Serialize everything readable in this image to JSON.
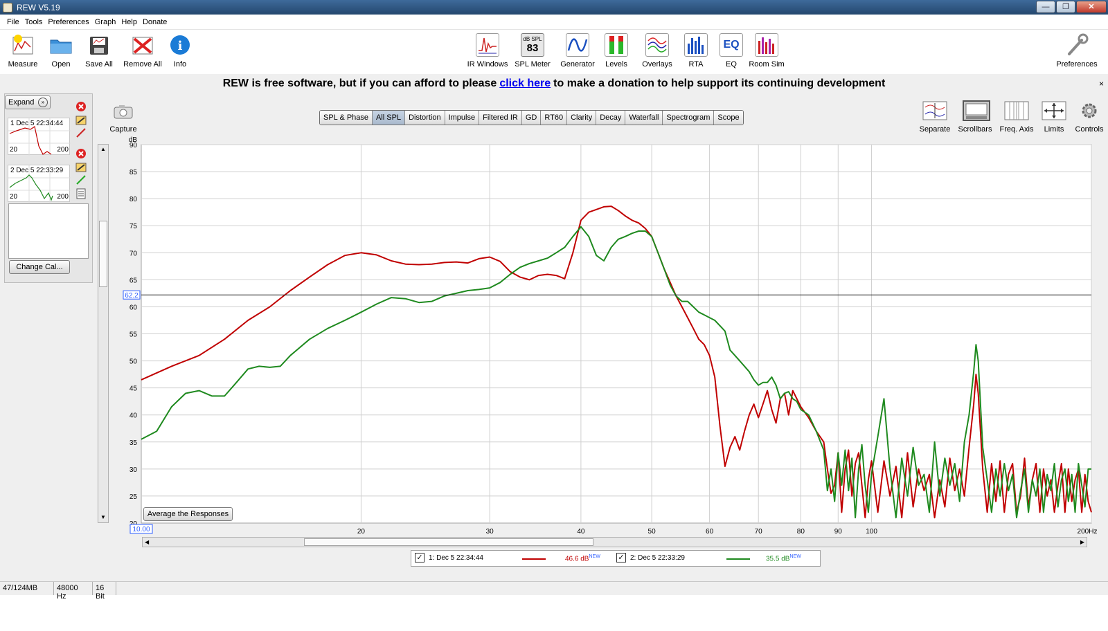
{
  "window": {
    "title": "REW V5.19",
    "min": "—",
    "max": "❐",
    "close": "✕"
  },
  "menu": [
    "File",
    "Tools",
    "Preferences",
    "Graph",
    "Help",
    "Donate"
  ],
  "toolbar_left": [
    {
      "label": "Measure",
      "icon": "measure-icon"
    },
    {
      "label": "Open",
      "icon": "folder-icon"
    },
    {
      "label": "Save All",
      "icon": "save-icon"
    },
    {
      "label": "Remove All",
      "icon": "remove-icon"
    },
    {
      "label": "Info",
      "icon": "info-icon"
    }
  ],
  "toolbar_center": [
    {
      "label": "IR Windows",
      "icon": "ir-windows-icon"
    },
    {
      "label": "SPL Meter",
      "icon": "spl-meter-icon",
      "badge_top": "dB SPL",
      "badge_value": "83"
    },
    {
      "label": "Generator",
      "icon": "generator-icon"
    },
    {
      "label": "Levels",
      "icon": "levels-icon"
    },
    {
      "label": "Overlays",
      "icon": "overlays-icon"
    },
    {
      "label": "RTA",
      "icon": "rta-icon"
    },
    {
      "label": "EQ",
      "icon": "eq-icon",
      "badge_value": "EQ"
    },
    {
      "label": "Room Sim",
      "icon": "room-sim-icon"
    }
  ],
  "preferences_label": "Preferences",
  "donate": {
    "before": "REW is free software, but if you can afford to please",
    "link": "click here",
    "after": "to make a donation to help support its continuing development",
    "close": "×"
  },
  "left_panel": {
    "expand": "Expand",
    "measurements": [
      {
        "label": "1 Dec 5 22:34:44",
        "lo": "20",
        "hi": "200",
        "color": "#c00000"
      },
      {
        "label": "2 Dec 5 22:33:29",
        "lo": "20",
        "hi": "200",
        "color": "#1f8a1f"
      }
    ],
    "change_cal": "Change Cal..."
  },
  "capture_label": "Capture",
  "tabs": [
    "SPL & Phase",
    "All SPL",
    "Distortion",
    "Impulse",
    "Filtered IR",
    "GD",
    "RT60",
    "Clarity",
    "Decay",
    "Waterfall",
    "Spectrogram",
    "Scope"
  ],
  "active_tab": "All SPL",
  "right_tools": [
    "Separate",
    "Scrollbars",
    "Freq. Axis",
    "Limits",
    "Controls"
  ],
  "avg_button": "Average the Responses",
  "cursor": {
    "y_value": "62.2",
    "x_value": "10.00"
  },
  "chart_data": {
    "type": "line",
    "ylabel": "dB",
    "xlabel": "",
    "x_unit": "Hz",
    "log_x": true,
    "xlim": [
      10,
      200
    ],
    "ylim": [
      20,
      90
    ],
    "x_ticks": [
      {
        "v": 20,
        "label": "20"
      },
      {
        "v": 30,
        "label": "30"
      },
      {
        "v": 40,
        "label": "40"
      },
      {
        "v": 50,
        "label": "50"
      },
      {
        "v": 60,
        "label": "60"
      },
      {
        "v": 70,
        "label": "70"
      },
      {
        "v": 80,
        "label": "80"
      },
      {
        "v": 90,
        "label": "90"
      },
      {
        "v": 100,
        "label": "100"
      },
      {
        "v": 200,
        "label": "200Hz"
      }
    ],
    "y_ticks": [
      25,
      30,
      35,
      40,
      45,
      50,
      55,
      60,
      65,
      70,
      75,
      80,
      85,
      90
    ],
    "grid": true,
    "hline": 62.2,
    "series": [
      {
        "name": "1: Dec 5 22:34:44",
        "color": "#c00000",
        "legend_value": "46.6 dB",
        "legend_sup": "NEW",
        "points": [
          [
            10,
            46.5
          ],
          [
            11,
            49
          ],
          [
            12,
            51
          ],
          [
            13,
            54
          ],
          [
            14,
            57.5
          ],
          [
            15,
            60
          ],
          [
            16,
            63
          ],
          [
            17,
            65.5
          ],
          [
            18,
            67.8
          ],
          [
            19,
            69.5
          ],
          [
            20,
            70
          ],
          [
            21,
            69.6
          ],
          [
            22,
            68.5
          ],
          [
            23,
            67.9
          ],
          [
            24,
            67.8
          ],
          [
            25,
            67.9
          ],
          [
            26,
            68.2
          ],
          [
            27,
            68.3
          ],
          [
            28,
            68.1
          ],
          [
            29,
            68.9
          ],
          [
            30,
            69.2
          ],
          [
            31,
            68.4
          ],
          [
            32,
            66.5
          ],
          [
            33,
            65.5
          ],
          [
            34,
            65
          ],
          [
            35,
            65.8
          ],
          [
            36,
            66
          ],
          [
            37,
            65.8
          ],
          [
            38,
            65.2
          ],
          [
            39,
            70
          ],
          [
            40,
            76
          ],
          [
            41,
            77.5
          ],
          [
            42,
            78
          ],
          [
            43,
            78.5
          ],
          [
            44,
            78.6
          ],
          [
            45,
            77.8
          ],
          [
            46,
            76.8
          ],
          [
            47,
            76
          ],
          [
            48,
            75.5
          ],
          [
            49,
            74.5
          ],
          [
            50,
            73
          ],
          [
            51,
            70
          ],
          [
            52,
            67
          ],
          [
            53,
            64.5
          ],
          [
            54,
            62
          ],
          [
            55,
            60
          ],
          [
            56,
            58
          ],
          [
            57,
            56
          ],
          [
            58,
            54
          ],
          [
            59,
            53
          ],
          [
            60,
            51
          ],
          [
            61,
            47
          ],
          [
            62,
            38
          ],
          [
            63,
            30.5
          ],
          [
            64,
            34
          ],
          [
            65,
            36
          ],
          [
            66,
            33.5
          ],
          [
            67,
            37
          ],
          [
            68,
            40
          ],
          [
            69,
            42
          ],
          [
            70,
            39.5
          ],
          [
            71,
            42
          ],
          [
            72,
            44.5
          ],
          [
            73,
            41
          ],
          [
            74,
            38.5
          ],
          [
            75,
            43
          ],
          [
            76,
            44
          ],
          [
            77,
            40
          ],
          [
            78,
            44.5
          ],
          [
            79,
            43
          ],
          [
            80,
            41.5
          ],
          [
            82,
            39.5
          ],
          [
            84,
            37
          ],
          [
            86,
            35
          ],
          [
            87,
            30
          ],
          [
            88,
            25.5
          ],
          [
            89,
            27
          ],
          [
            90,
            33
          ],
          [
            91,
            22
          ],
          [
            92,
            30
          ],
          [
            93,
            33.5
          ],
          [
            94,
            25
          ],
          [
            95,
            31
          ],
          [
            96,
            33
          ],
          [
            97,
            27
          ],
          [
            98,
            21
          ],
          [
            99,
            28
          ],
          [
            100,
            31.5
          ],
          [
            102,
            22
          ],
          [
            104,
            31.5
          ],
          [
            106,
            25
          ],
          [
            108,
            30.5
          ],
          [
            110,
            21
          ],
          [
            112,
            33
          ],
          [
            114,
            23
          ],
          [
            116,
            30
          ],
          [
            118,
            26
          ],
          [
            120,
            29
          ],
          [
            122,
            21
          ],
          [
            124,
            28
          ],
          [
            126,
            23
          ],
          [
            128,
            32
          ],
          [
            130,
            26
          ],
          [
            132,
            30
          ],
          [
            134,
            25
          ],
          [
            136,
            34
          ],
          [
            138,
            42
          ],
          [
            139,
            47.5
          ],
          [
            140,
            44
          ],
          [
            142,
            30
          ],
          [
            144,
            22
          ],
          [
            146,
            31
          ],
          [
            148,
            24
          ],
          [
            150,
            31.5
          ],
          [
            152,
            22
          ],
          [
            154,
            29
          ],
          [
            156,
            31
          ],
          [
            158,
            22
          ],
          [
            160,
            25
          ],
          [
            162,
            32
          ],
          [
            164,
            23
          ],
          [
            166,
            28
          ],
          [
            168,
            31
          ],
          [
            170,
            22
          ],
          [
            172,
            30
          ],
          [
            174,
            25
          ],
          [
            176,
            28
          ],
          [
            178,
            22
          ],
          [
            180,
            27
          ],
          [
            182,
            31
          ],
          [
            184,
            22
          ],
          [
            186,
            30
          ],
          [
            188,
            24
          ],
          [
            190,
            28
          ],
          [
            192,
            30
          ],
          [
            194,
            22
          ],
          [
            196,
            29
          ],
          [
            198,
            24
          ],
          [
            200,
            22
          ]
        ]
      },
      {
        "name": "2: Dec 5 22:33:29",
        "color": "#1f8a1f",
        "legend_value": "35.5 dB",
        "legend_sup": "NEW",
        "points": [
          [
            10,
            35.5
          ],
          [
            10.5,
            37
          ],
          [
            11,
            41.5
          ],
          [
            11.5,
            44
          ],
          [
            12,
            44.5
          ],
          [
            12.5,
            43.5
          ],
          [
            13,
            43.5
          ],
          [
            13.5,
            46
          ],
          [
            14,
            48.5
          ],
          [
            14.5,
            49
          ],
          [
            15,
            48.8
          ],
          [
            15.5,
            49
          ],
          [
            16,
            51
          ],
          [
            17,
            54
          ],
          [
            18,
            56
          ],
          [
            19,
            57.5
          ],
          [
            20,
            59
          ],
          [
            21,
            60.5
          ],
          [
            22,
            61.7
          ],
          [
            23,
            61.5
          ],
          [
            24,
            60.8
          ],
          [
            25,
            61
          ],
          [
            26,
            62
          ],
          [
            27,
            62.5
          ],
          [
            28,
            63
          ],
          [
            29,
            63.2
          ],
          [
            30,
            63.5
          ],
          [
            31,
            64.5
          ],
          [
            32,
            66
          ],
          [
            33,
            67.3
          ],
          [
            34,
            68
          ],
          [
            35,
            68.5
          ],
          [
            36,
            69
          ],
          [
            37,
            70
          ],
          [
            38,
            71
          ],
          [
            39,
            73
          ],
          [
            40,
            74.8
          ],
          [
            41,
            73
          ],
          [
            42,
            69.5
          ],
          [
            43,
            68.5
          ],
          [
            44,
            71
          ],
          [
            45,
            72.5
          ],
          [
            46,
            73
          ],
          [
            47,
            73.6
          ],
          [
            48,
            74
          ],
          [
            49,
            74
          ],
          [
            50,
            73
          ],
          [
            51,
            70
          ],
          [
            52,
            67
          ],
          [
            53,
            64
          ],
          [
            54,
            62
          ],
          [
            55,
            61
          ],
          [
            56,
            61
          ],
          [
            57,
            60
          ],
          [
            58,
            59
          ],
          [
            59,
            58.5
          ],
          [
            60,
            58
          ],
          [
            61,
            57.5
          ],
          [
            62,
            56.5
          ],
          [
            63,
            55.5
          ],
          [
            64,
            52
          ],
          [
            65,
            51
          ],
          [
            66,
            50
          ],
          [
            67,
            49
          ],
          [
            68,
            48
          ],
          [
            69,
            46.5
          ],
          [
            70,
            45.5
          ],
          [
            71,
            46
          ],
          [
            72,
            46
          ],
          [
            73,
            47
          ],
          [
            74,
            45.5
          ],
          [
            75,
            43
          ],
          [
            76,
            44
          ],
          [
            77,
            44.3
          ],
          [
            78,
            43
          ],
          [
            79,
            42.5
          ],
          [
            80,
            41
          ],
          [
            82,
            40
          ],
          [
            84,
            37
          ],
          [
            86,
            33.5
          ],
          [
            87,
            26
          ],
          [
            88,
            30
          ],
          [
            89,
            24
          ],
          [
            90,
            33
          ],
          [
            91,
            27
          ],
          [
            92,
            33.5
          ],
          [
            93,
            26
          ],
          [
            94,
            32
          ],
          [
            95,
            21
          ],
          [
            96,
            30
          ],
          [
            97,
            34.5
          ],
          [
            98,
            27
          ],
          [
            99,
            22
          ],
          [
            100,
            29
          ],
          [
            102,
            36
          ],
          [
            104,
            43
          ],
          [
            106,
            30
          ],
          [
            108,
            21
          ],
          [
            110,
            32
          ],
          [
            112,
            25
          ],
          [
            114,
            34
          ],
          [
            116,
            27
          ],
          [
            118,
            29
          ],
          [
            120,
            22
          ],
          [
            122,
            35
          ],
          [
            124,
            25
          ],
          [
            126,
            32
          ],
          [
            128,
            27
          ],
          [
            130,
            31
          ],
          [
            132,
            24
          ],
          [
            134,
            35
          ],
          [
            136,
            40
          ],
          [
            138,
            48
          ],
          [
            139,
            53
          ],
          [
            140,
            50
          ],
          [
            142,
            34
          ],
          [
            144,
            28
          ],
          [
            146,
            22
          ],
          [
            148,
            30
          ],
          [
            150,
            25
          ],
          [
            152,
            31
          ],
          [
            154,
            26
          ],
          [
            156,
            29
          ],
          [
            158,
            21
          ],
          [
            160,
            26
          ],
          [
            162,
            30
          ],
          [
            164,
            22
          ],
          [
            166,
            28
          ],
          [
            168,
            25
          ],
          [
            170,
            30
          ],
          [
            172,
            22
          ],
          [
            174,
            29
          ],
          [
            176,
            26
          ],
          [
            178,
            31
          ],
          [
            180,
            23
          ],
          [
            182,
            28
          ],
          [
            184,
            30
          ],
          [
            186,
            24
          ],
          [
            188,
            29
          ],
          [
            190,
            22
          ],
          [
            192,
            31
          ],
          [
            194,
            27
          ],
          [
            196,
            23
          ],
          [
            198,
            30
          ],
          [
            200,
            30
          ]
        ]
      }
    ]
  },
  "status": [
    "47/124MB",
    "48000 Hz",
    "16 Bit"
  ]
}
